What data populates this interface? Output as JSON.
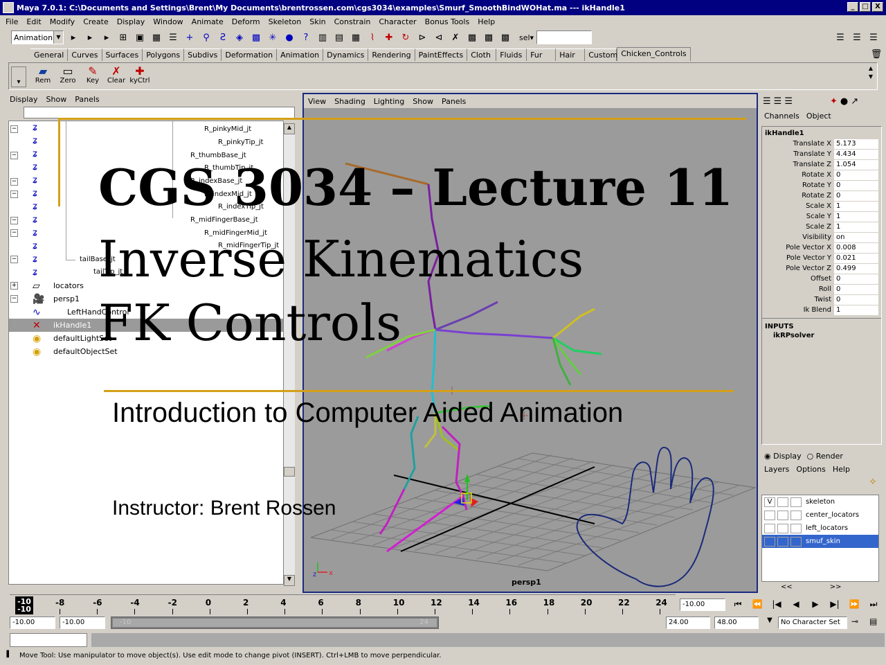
{
  "window": {
    "title": "Maya 7.0.1: C:\\Documents and Settings\\Brent\\My Documents\\brentrossen.com\\cgs3034\\examples\\Smurf_SmoothBindWOHat.ma  ---  ikHandle1",
    "min": "_",
    "max": "□",
    "close": "X"
  },
  "menubar": [
    "File",
    "Edit",
    "Modify",
    "Create",
    "Display",
    "Window",
    "Animate",
    "Deform",
    "Skeleton",
    "Skin",
    "Constrain",
    "Character",
    "Bonus Tools",
    "Help"
  ],
  "statusline": {
    "menu_set": "Animation",
    "sel_label": "sel▾",
    "sel_value": ""
  },
  "shelf": {
    "tabs": [
      "General",
      "Curves",
      "Surfaces",
      "Polygons",
      "Subdivs",
      "Deformation",
      "Animation",
      "Dynamics",
      "Rendering",
      "PaintEffects",
      "Cloth",
      "Fluids",
      "Fur",
      "Hair",
      "Custom",
      "Chicken_Controls"
    ],
    "active_tab": "Chicken_Controls",
    "buttons": [
      "Rem",
      "Zero",
      "Key",
      "Clear",
      "kyCtrl"
    ]
  },
  "outliner": {
    "menu": [
      "Display",
      "Show",
      "Panels"
    ],
    "filter": "",
    "joints": [
      "R_pinkyMid_jt",
      "R_pinkyTip_jt",
      "R_thumbBase_jt",
      "R_thumbTip_jt",
      "R_indexBase_jt",
      "R_indexMid_jt",
      "R_indexTip_jt",
      "R_midFingerBase_jt",
      "R_midFingerMid_jt",
      "R_midFingerTip_jt",
      "tailBase_jt",
      "tailTip_jt"
    ],
    "items": [
      {
        "label": "locators",
        "icon": "locator-group-icon"
      },
      {
        "label": "persp1",
        "icon": "camera-icon"
      },
      {
        "label": "LeftHandControl",
        "icon": "curve-icon"
      },
      {
        "label": "ikHandle1",
        "icon": "ik-handle-icon"
      },
      {
        "label": "defaultLightSet",
        "icon": "set-icon"
      },
      {
        "label": "defaultObjectSet",
        "icon": "set-icon"
      }
    ]
  },
  "viewport": {
    "menu": [
      "View",
      "Shading",
      "Lighting",
      "Show",
      "Panels"
    ],
    "camera_label": "persp1",
    "axis_x": "x",
    "axis_z": "z"
  },
  "channelbox": {
    "menu": [
      "Channels",
      "Object"
    ],
    "node": "ikHandle1",
    "attrs": [
      {
        "name": "Translate X",
        "value": "5.173"
      },
      {
        "name": "Translate Y",
        "value": "4.434"
      },
      {
        "name": "Translate Z",
        "value": "1.054"
      },
      {
        "name": "Rotate X",
        "value": "0"
      },
      {
        "name": "Rotate Y",
        "value": "0"
      },
      {
        "name": "Rotate Z",
        "value": "0"
      },
      {
        "name": "Scale X",
        "value": "1"
      },
      {
        "name": "Scale Y",
        "value": "1"
      },
      {
        "name": "Scale Z",
        "value": "1"
      },
      {
        "name": "Visibility",
        "value": "on"
      },
      {
        "name": "Pole Vector X",
        "value": "0.008"
      },
      {
        "name": "Pole Vector Y",
        "value": "0.021"
      },
      {
        "name": "Pole Vector Z",
        "value": "0.499"
      },
      {
        "name": "Offset",
        "value": "0"
      },
      {
        "name": "Roll",
        "value": "0"
      },
      {
        "name": "Twist",
        "value": "0"
      },
      {
        "name": "Ik Blend",
        "value": "1"
      }
    ],
    "inputs_label": "INPUTS",
    "input_node": "ikRPsolver"
  },
  "layers": {
    "display_label": "Display",
    "render_label": "Render",
    "menu": [
      "Layers",
      "Options",
      "Help"
    ],
    "list": [
      {
        "name": "skeleton",
        "v": "V",
        "selected": false
      },
      {
        "name": "center_locators",
        "v": "",
        "selected": false
      },
      {
        "name": "left_locators",
        "v": "",
        "selected": false
      },
      {
        "name": "smuf_skin",
        "v": "",
        "selected": true
      }
    ],
    "prev": "<<",
    "next": ">>"
  },
  "timeline": {
    "current": "-10",
    "ticks": [
      "-8",
      "-6",
      "-4",
      "-2",
      "0",
      "2",
      "4",
      "6",
      "8",
      "10",
      "12",
      "14",
      "16",
      "18",
      "20",
      "22",
      "24"
    ],
    "current_field": "-10.00",
    "start": "-10.00",
    "playback_start": "-10.00",
    "range_start": "-10",
    "range_end": "24",
    "playback_end": "24.00",
    "end": "48.00",
    "character_set": "No Character Set"
  },
  "helpline": "Move Tool: Use manipulator to move object(s). Use edit mode to change pivot (INSERT).  Ctrl+LMB to move perpendicular.",
  "slide": {
    "title": "CGS 3034 – Lecture 11",
    "subtitle_1": "Inverse Kinematics",
    "subtitle_2": "FK Controls",
    "course": "Introduction to Computer Aided Animation",
    "instructor": "Instructor: Brent Rossen"
  },
  "colors": {
    "accent_gold": "#d4a017",
    "titlebar": "#000080",
    "viewport_bg": "#9b9b9b",
    "selection": "#3366cc"
  }
}
